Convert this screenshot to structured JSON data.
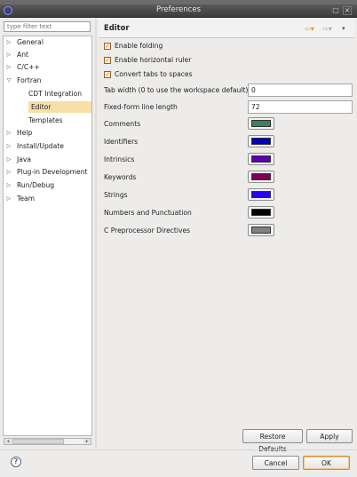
{
  "window": {
    "title": "Preferences",
    "close_glyph": "×",
    "max_glyph": "▢"
  },
  "filter": {
    "placeholder": "type filter text"
  },
  "tree": {
    "items": [
      {
        "label": "General",
        "expander": "▷"
      },
      {
        "label": "Ant",
        "expander": "▷"
      },
      {
        "label": "C/C++",
        "expander": "▷"
      },
      {
        "label": "Fortran",
        "expander": "▽"
      },
      {
        "label": "CDT Integration",
        "expander": ""
      },
      {
        "label": "Editor",
        "expander": ""
      },
      {
        "label": "Templates",
        "expander": ""
      },
      {
        "label": "Help",
        "expander": "▷"
      },
      {
        "label": "Install/Update",
        "expander": "▷"
      },
      {
        "label": "Java",
        "expander": "▷"
      },
      {
        "label": "Plug-in Development",
        "expander": "▷"
      },
      {
        "label": "Run/Debug",
        "expander": "▷"
      },
      {
        "label": "Team",
        "expander": "▷"
      }
    ],
    "selected": "Editor"
  },
  "page": {
    "title": "Editor",
    "nav": {
      "back": "⇦▾",
      "forward": "⇨▾",
      "menu": "▾"
    },
    "checkboxes": [
      {
        "label": "Enable folding",
        "checked": true,
        "mark": "✓"
      },
      {
        "label": "Enable horizontal ruler",
        "checked": true,
        "mark": "✓"
      },
      {
        "label": "Convert tabs to spaces",
        "checked": true,
        "mark": "✓"
      }
    ],
    "fields": [
      {
        "label": "Tab width (0 to use the workspace default)",
        "value": "0"
      },
      {
        "label": "Fixed-form line length",
        "value": "72"
      }
    ],
    "colors": [
      {
        "label": "Comments",
        "color": "#3f7f5f"
      },
      {
        "label": "Identifiers",
        "color": "#0000c0"
      },
      {
        "label": "Intrinsics",
        "color": "#5a00b4"
      },
      {
        "label": "Keywords",
        "color": "#7f0055"
      },
      {
        "label": "Strings",
        "color": "#2a00ff"
      },
      {
        "label": "Numbers and Punctuation",
        "color": "#000000"
      },
      {
        "label": "C Preprocessor Directives",
        "color": "#808080"
      }
    ],
    "restore_defaults": "Restore Defaults",
    "apply": "Apply"
  },
  "footer": {
    "help": "?",
    "cancel": "Cancel",
    "ok": "OK"
  },
  "scroll": {
    "left": "◂",
    "right": "▸"
  }
}
